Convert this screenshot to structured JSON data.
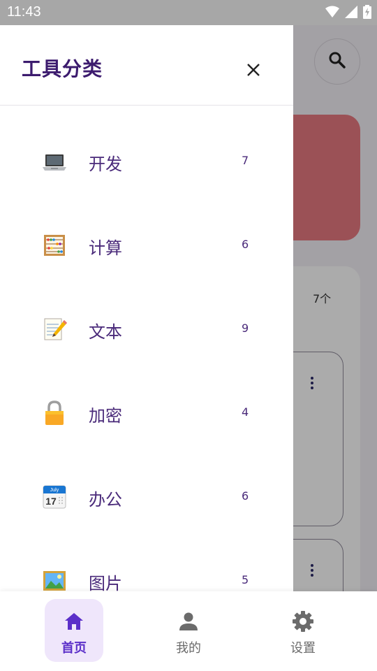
{
  "status_bar": {
    "time": "11:43"
  },
  "background": {
    "count_text": "7个"
  },
  "drawer": {
    "title": "工具分类",
    "categories": [
      {
        "label": "开发",
        "count": "7",
        "icon": "laptop-icon"
      },
      {
        "label": "计算",
        "count": "6",
        "icon": "abacus-icon"
      },
      {
        "label": "文本",
        "count": "9",
        "icon": "memo-icon"
      },
      {
        "label": "加密",
        "count": "4",
        "icon": "lock-icon"
      },
      {
        "label": "办公",
        "count": "6",
        "icon": "calendar-icon",
        "calendar_month": "July",
        "calendar_day": "17"
      },
      {
        "label": "图片",
        "count": "5",
        "icon": "picture-icon"
      }
    ]
  },
  "bottom_nav": {
    "items": [
      {
        "label": "首页",
        "icon": "home-icon",
        "active": true
      },
      {
        "label": "我的",
        "icon": "person-icon",
        "active": false
      },
      {
        "label": "设置",
        "icon": "gear-icon",
        "active": false
      }
    ]
  },
  "colors": {
    "accent": "#5b2fc9",
    "drawer_text": "#4a2a7a",
    "title": "#3c1b6e",
    "banner": "#e77a80",
    "status_bar": "#a7a7a7"
  }
}
